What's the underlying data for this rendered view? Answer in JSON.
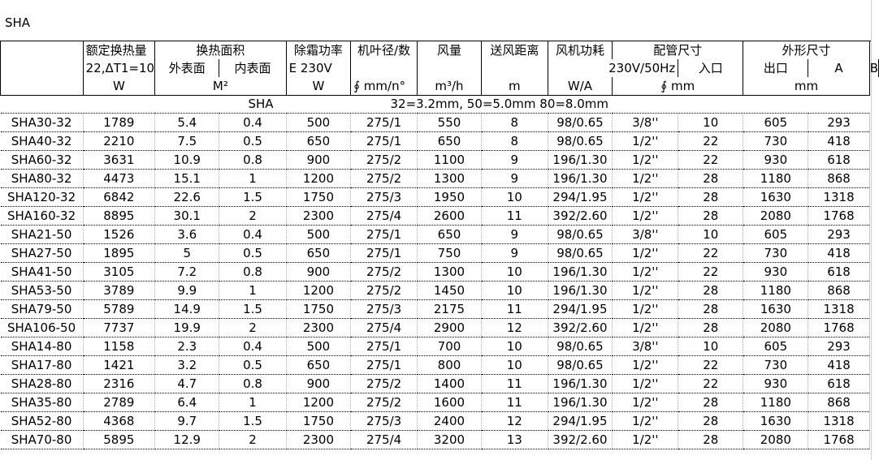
{
  "sheet_title": "SHA",
  "header": {
    "row1": [
      "额定换热量",
      "换热面积",
      "除霜功率",
      "机叶径/数",
      "风量",
      "送风距离",
      "风机功耗",
      "配管尺寸",
      "外形尺寸"
    ],
    "row2": [
      "22,ΔT1=10",
      "外表面",
      "内表面",
      "E   230V",
      "230V/50Hz",
      "入口",
      "出口",
      "A",
      "B"
    ],
    "row3": [
      "W",
      "M²",
      "W",
      "∮  mm/n°",
      "m³/h",
      "m",
      "W/A",
      "∮  mm",
      "mm"
    ]
  },
  "series_note": {
    "label": "SHA",
    "text": "32=3.2mm,    50=5.0mm  80=8.0mm"
  },
  "rows": [
    [
      "SHA30-32",
      "1789",
      "5.4",
      "0.4",
      "500",
      "275/1",
      "550",
      "8",
      "98/0.65",
      "3/8''",
      "10",
      "605",
      "293"
    ],
    [
      "SHA40-32",
      "2210",
      "7.5",
      "0.5",
      "650",
      "275/1",
      "650",
      "8",
      "98/0.65",
      "1/2''",
      "22",
      "730",
      "418"
    ],
    [
      "SHA60-32",
      "3631",
      "10.9",
      "0.8",
      "900",
      "275/2",
      "1100",
      "9",
      "196/1.30",
      "1/2''",
      "22",
      "930",
      "618"
    ],
    [
      "SHA80-32",
      "4473",
      "15.1",
      "1",
      "1200",
      "275/2",
      "1300",
      "9",
      "196/1.30",
      "1/2''",
      "28",
      "1180",
      "868"
    ],
    [
      "SHA120-32",
      "6842",
      "22.6",
      "1.5",
      "1750",
      "275/3",
      "1950",
      "10",
      "294/1.95",
      "1/2''",
      "28",
      "1630",
      "1318"
    ],
    [
      "SHA160-32",
      "8895",
      "30.1",
      "2",
      "2300",
      "275/4",
      "2600",
      "11",
      "392/2.60",
      "1/2''",
      "28",
      "2080",
      "1768"
    ],
    [
      "SHA21-50",
      "1526",
      "3.6",
      "0.4",
      "500",
      "275/1",
      "650",
      "9",
      "98/0.65",
      "3/8''",
      "10",
      "605",
      "293"
    ],
    [
      "SHA27-50",
      "1895",
      "5",
      "0.5",
      "650",
      "275/1",
      "750",
      "9",
      "98/0.65",
      "1/2''",
      "22",
      "730",
      "418"
    ],
    [
      "SHA41-50",
      "3105",
      "7.2",
      "0.8",
      "900",
      "275/2",
      "1300",
      "10",
      "196/1.30",
      "1/2''",
      "22",
      "930",
      "618"
    ],
    [
      "SHA53-50",
      "3789",
      "9.9",
      "1",
      "1200",
      "275/2",
      "1450",
      "10",
      "196/1.30",
      "1/2''",
      "28",
      "1180",
      "868"
    ],
    [
      "SHA79-50",
      "5789",
      "14.9",
      "1.5",
      "1750",
      "275/3",
      "2175",
      "11",
      "294/1.95",
      "1/2''",
      "28",
      "1630",
      "1318"
    ],
    [
      "SHA106-50",
      "7737",
      "19.9",
      "2",
      "2300",
      "275/4",
      "2900",
      "12",
      "392/2.60",
      "1/2''",
      "28",
      "2080",
      "1768"
    ],
    [
      "SHA14-80",
      "1158",
      "2.3",
      "0.4",
      "500",
      "275/1",
      "700",
      "10",
      "98/0.65",
      "3/8''",
      "10",
      "605",
      "293"
    ],
    [
      "SHA17-80",
      "1421",
      "3.2",
      "0.5",
      "650",
      "275/1",
      "800",
      "10",
      "98/0.65",
      "1/2''",
      "22",
      "730",
      "418"
    ],
    [
      "SHA28-80",
      "2316",
      "4.7",
      "0.8",
      "900",
      "275/2",
      "1400",
      "11",
      "196/1.30",
      "1/2''",
      "22",
      "930",
      "618"
    ],
    [
      "SHA35-80",
      "2789",
      "6.4",
      "1",
      "1200",
      "275/2",
      "1600",
      "11",
      "196/1.30",
      "1/2''",
      "28",
      "1180",
      "868"
    ],
    [
      "SHA52-80",
      "4368",
      "9.7",
      "1.5",
      "1750",
      "275/3",
      "2400",
      "12",
      "294/1.95",
      "1/2''",
      "28",
      "1630",
      "1318"
    ],
    [
      "SHA70-80",
      "5895",
      "12.9",
      "2",
      "2300",
      "275/4",
      "3200",
      "13",
      "392/2.60",
      "1/2''",
      "28",
      "2080",
      "1768"
    ]
  ]
}
